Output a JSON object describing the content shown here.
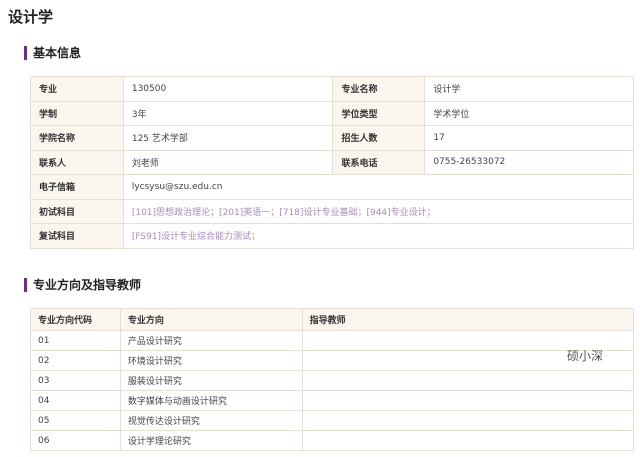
{
  "page_title": "设计学",
  "basic": {
    "heading": "基本信息",
    "rows": [
      {
        "k1": "专业",
        "v1": "130500",
        "k2": "专业名称",
        "v2": "设计学"
      },
      {
        "k1": "学制",
        "v1": "3年",
        "k2": "学位类型",
        "v2": "学术学位"
      },
      {
        "k1": "学院名称",
        "v1": "125 艺术学部",
        "k2": "招生人数",
        "v2": "17"
      },
      {
        "k1": "联系人",
        "v1": "刘老师",
        "k2": "联系电话",
        "v2": "0755-26533072"
      }
    ],
    "email_label": "电子信箱",
    "email": "lycsysu@szu.edu.cn",
    "first_exam_label": "初试科目",
    "first_exam": "[101]思想政治理论；[201]英语一；[718]设计专业基础；[944]专业设计；",
    "retest_label": "复试科目",
    "retest": "[FS91]设计专业综合能力测试；",
    "link_color": "#a78bc0"
  },
  "directions": {
    "heading": "专业方向及指导教师",
    "headers": [
      "专业方向代码",
      "专业方向",
      "指导教师"
    ],
    "rows": [
      {
        "code": "01",
        "name": "产品设计研究",
        "tutor": ""
      },
      {
        "code": "02",
        "name": "环境设计研究",
        "tutor": ""
      },
      {
        "code": "03",
        "name": "服装设计研究",
        "tutor": ""
      },
      {
        "code": "04",
        "name": "数字媒体与动画设计研究",
        "tutor": ""
      },
      {
        "code": "05",
        "name": "视觉传达设计研究",
        "tutor": ""
      },
      {
        "code": "06",
        "name": "设计学理论研究",
        "tutor": ""
      }
    ]
  },
  "watermark": "硕小深",
  "accent_color": "#6e2a8d"
}
